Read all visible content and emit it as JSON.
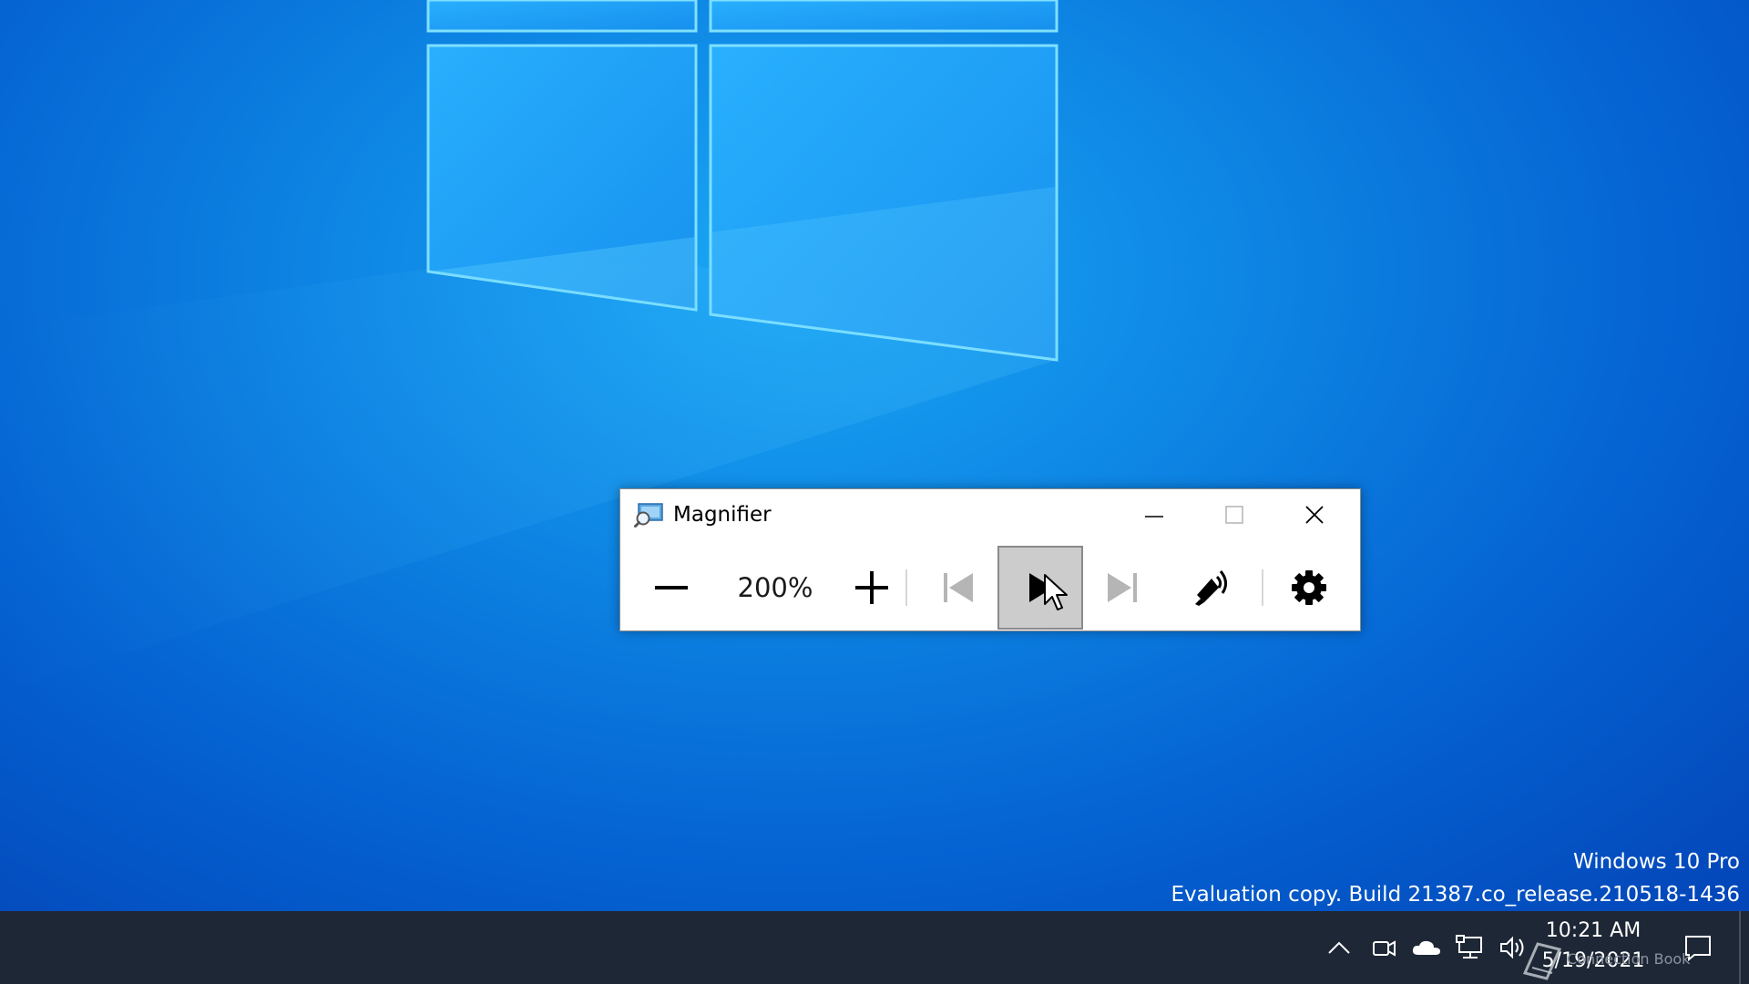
{
  "desktop": {
    "watermark_line1": "Windows 10 Pro",
    "watermark_line2": "Evaluation copy. Build 21387.co_release.210518-1436"
  },
  "magnifier": {
    "title": "Magnifier",
    "zoom_level": "200%",
    "play_pressed": true
  },
  "taskbar": {
    "time": "10:21 AM",
    "date": "5/19/2021",
    "tooltip_ghost": "Connection Book"
  },
  "colors": {
    "desktop_accent": "#0d84e3",
    "taskbar": "#1e2735",
    "pressed_button": "#cccccc"
  }
}
